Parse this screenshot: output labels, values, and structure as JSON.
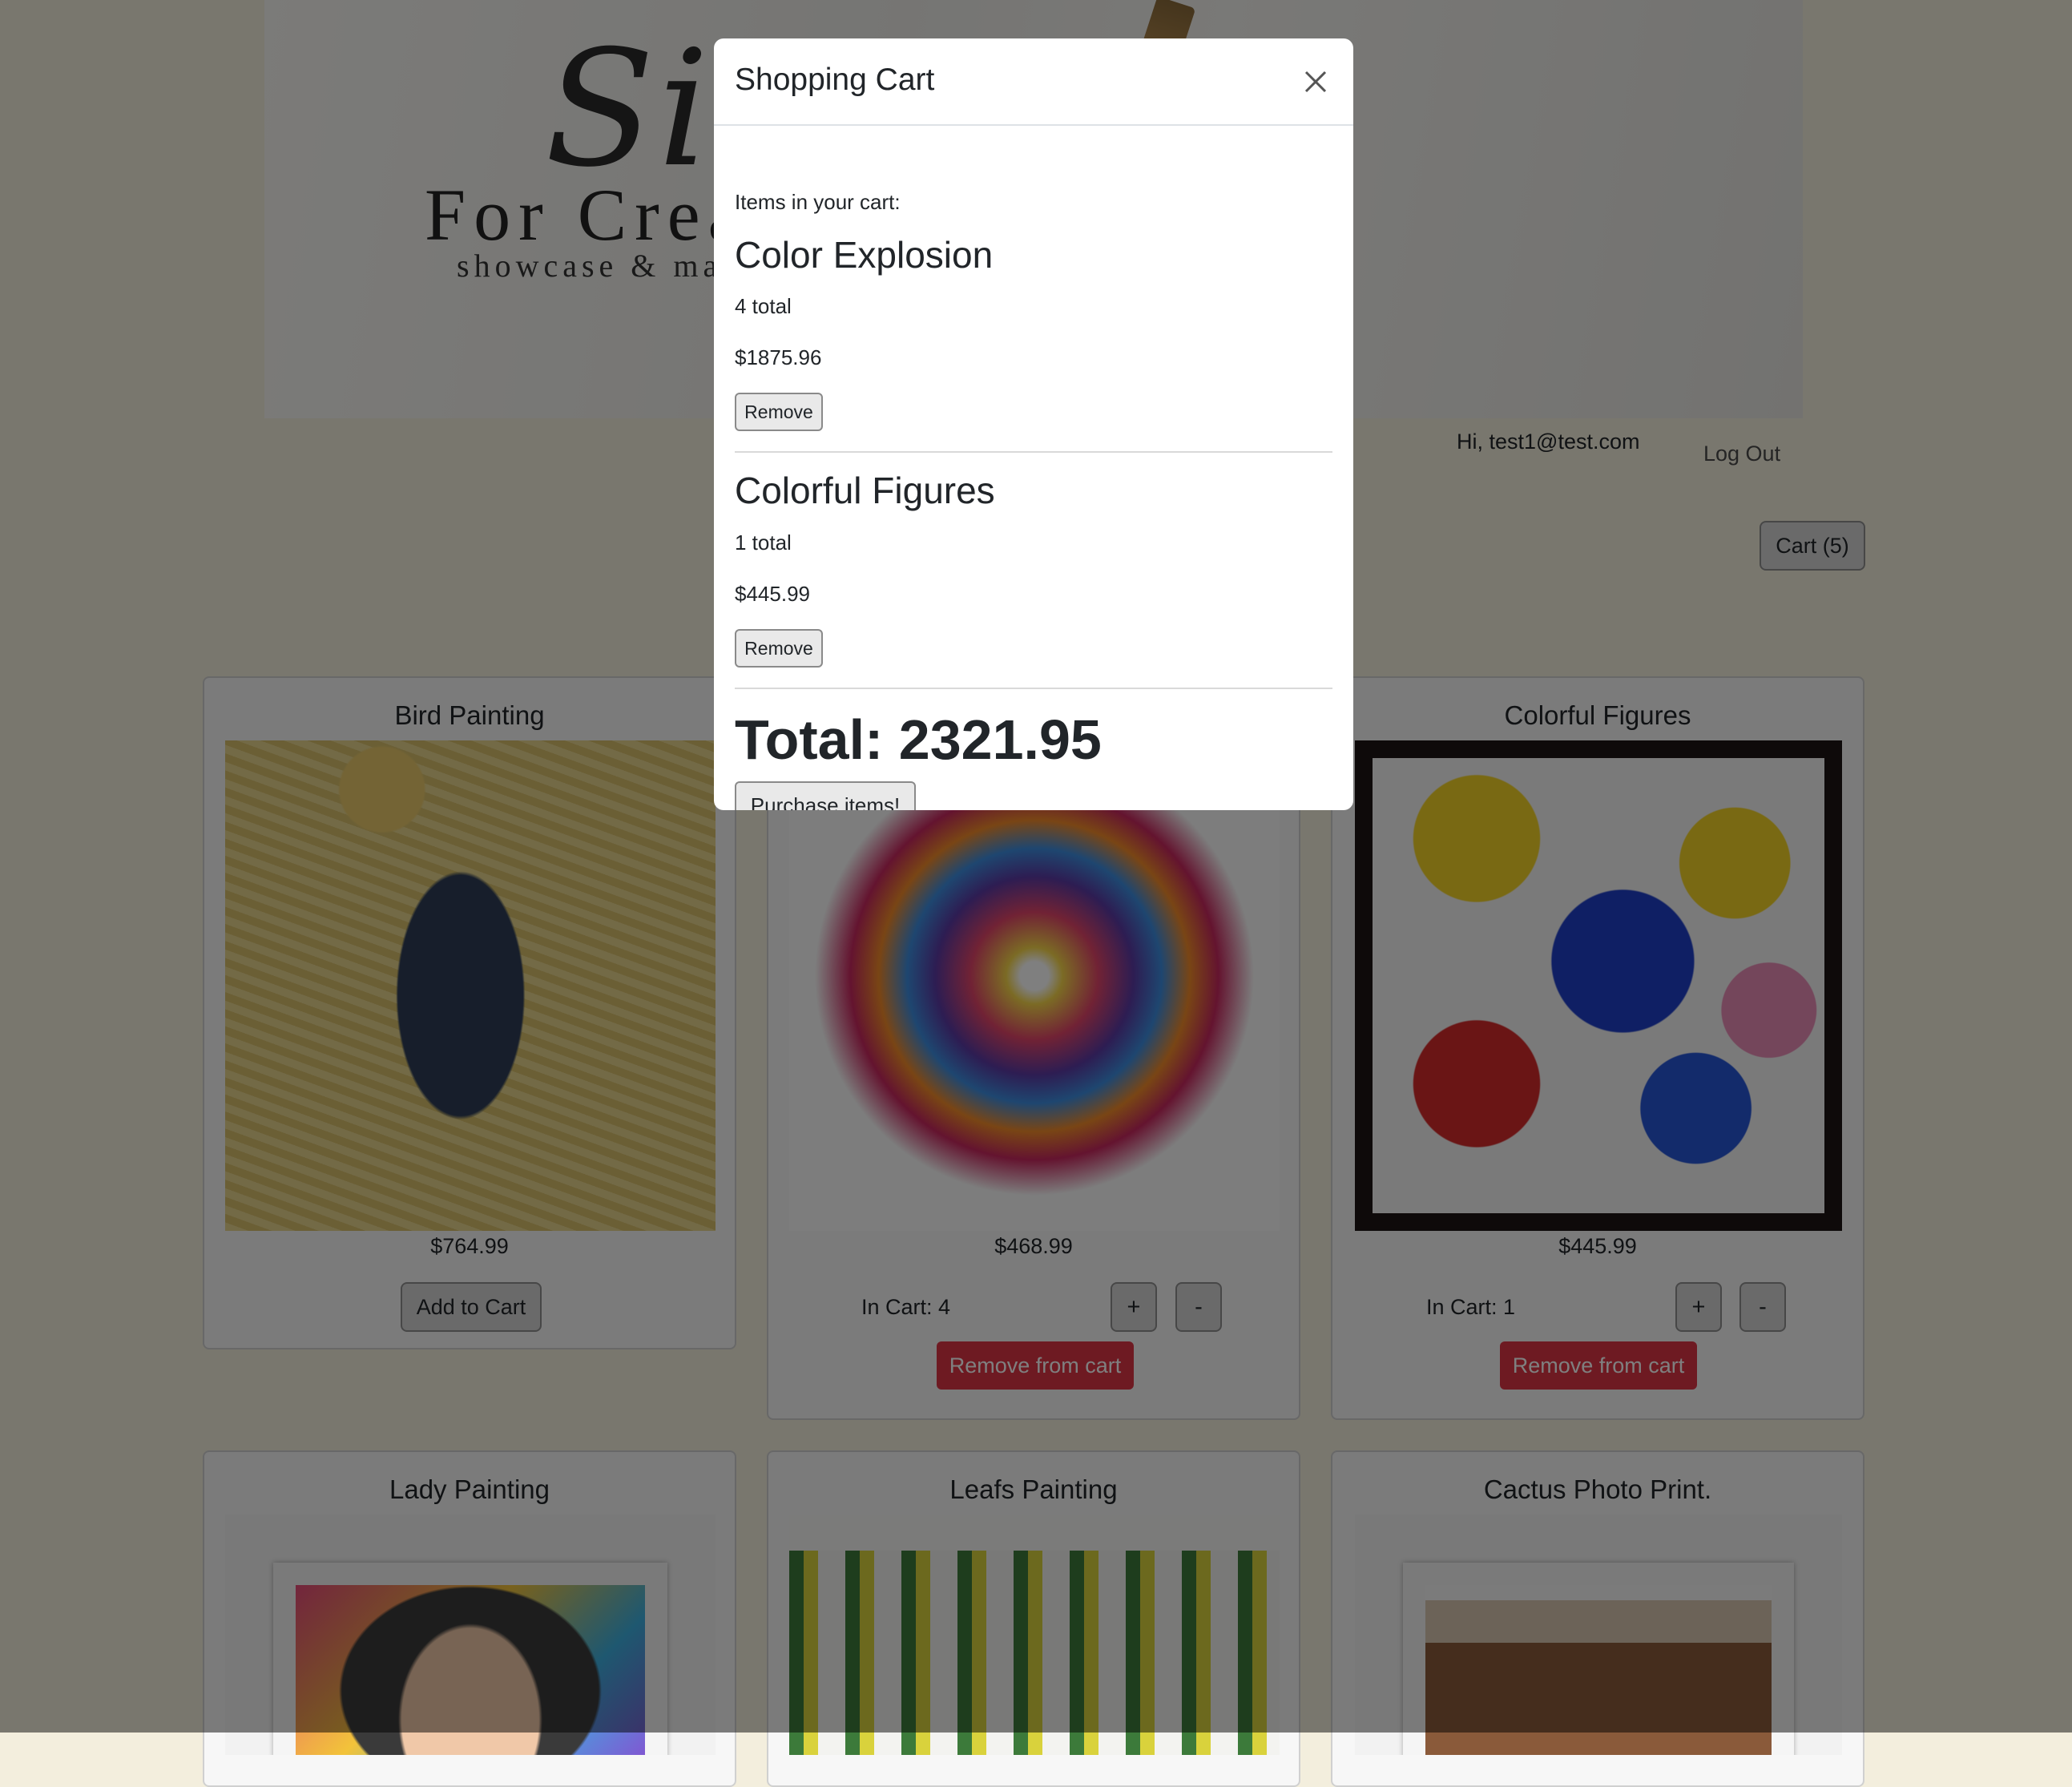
{
  "header": {
    "logo_script": "Sist",
    "logo_main": "For Crea",
    "logo_sub": "showcase & marke",
    "greeting": "Hi, test1@test.com",
    "logout_label": "Log Out",
    "cart_label": "Cart (5)"
  },
  "products": [
    {
      "title": "Bird Painting",
      "price": "$764.99",
      "add_label": "Add to Cart"
    },
    {
      "title": "",
      "price": "$468.99",
      "in_cart": "In Cart: 4",
      "plus": "+",
      "minus": "-",
      "remove_label": "Remove from cart"
    },
    {
      "title": "Colorful Figures",
      "price": "$445.99",
      "in_cart": "In Cart: 1",
      "plus": "+",
      "minus": "-",
      "remove_label": "Remove from cart"
    },
    {
      "title": "Lady Painting"
    },
    {
      "title": "Leafs Painting"
    },
    {
      "title": "Cactus Photo Print."
    }
  ],
  "modal": {
    "title": "Shopping Cart",
    "items_label": "Items in your cart:",
    "items": [
      {
        "name": "Color Explosion",
        "count": "4 total",
        "price": "$1875.96",
        "remove_label": "Remove"
      },
      {
        "name": "Colorful Figures",
        "count": "1 total",
        "price": "$445.99",
        "remove_label": "Remove"
      }
    ],
    "total": "Total: 2321.95",
    "purchase_label": "Purchase items!"
  },
  "icons": {
    "close": "close-icon"
  },
  "colors": {
    "page_background": "#f3eedd",
    "danger": "#dc3545",
    "overlay": "rgba(0,0,0,0.5)"
  }
}
